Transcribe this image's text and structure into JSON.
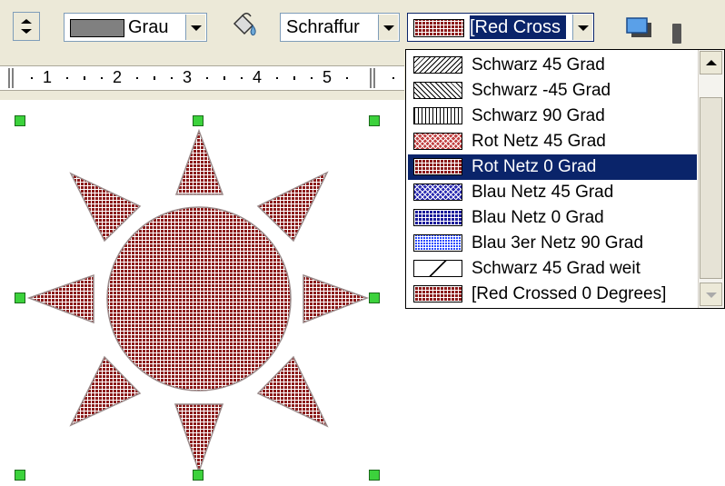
{
  "toolbar": {
    "line_color": {
      "label": "Grau",
      "swatch_color": "#808080"
    },
    "fill_bucket_icon": "paint-bucket-icon",
    "area_style": {
      "value": "Schraffur"
    },
    "hatch_select": {
      "value": "[Red Cross"
    },
    "shadow_icon": "shadow-icon"
  },
  "ruler": {
    "ticks": [
      "1",
      "2",
      "3",
      "4",
      "5"
    ]
  },
  "dropdown": {
    "items": [
      {
        "label": "Schwarz 45 Grad",
        "pattern": "hatch-45"
      },
      {
        "label": "Schwarz -45 Grad",
        "pattern": "hatch-m45"
      },
      {
        "label": "Schwarz 90 Grad",
        "pattern": "hatch-90"
      },
      {
        "label": "Rot Netz 45 Grad",
        "pattern": "hatch-red-45"
      },
      {
        "label": "Rot Netz 0 Grad",
        "pattern": "hatch-red",
        "selected": true
      },
      {
        "label": "Blau Netz 45 Grad",
        "pattern": "hatch-blue-45"
      },
      {
        "label": "Blau Netz 0 Grad",
        "pattern": "hatch-blue-0"
      },
      {
        "label": "Blau 3er Netz 90 Grad",
        "pattern": "hatch-blue-3"
      },
      {
        "label": "Schwarz 45 Grad weit",
        "pattern": "hatch-45w"
      },
      {
        "label": "[Red Crossed 0 Degrees]",
        "pattern": "hatch-red"
      }
    ]
  },
  "colors": {
    "selection_highlight": "#0a246a",
    "hatch_red": "#8b1a1a",
    "handle_green": "#3cd23c",
    "toolbar_bg": "#ece9d8"
  }
}
